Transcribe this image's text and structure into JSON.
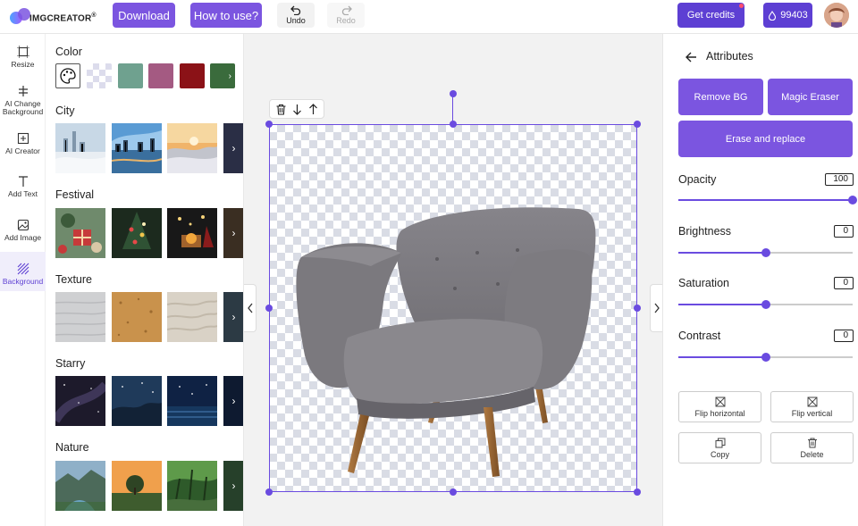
{
  "header": {
    "logo_text": "IMGCREATOR",
    "logo_mark": "®",
    "download_label": "Download",
    "howto_label": "How to use?",
    "undo_label": "Undo",
    "redo_label": "Redo",
    "credits_label": "Get credits",
    "credit_count": "99403",
    "accent_color": "#7b55e0"
  },
  "rail": {
    "items": [
      {
        "label": "Resize",
        "icon": "resize-icon"
      },
      {
        "label": "AI Change Background",
        "icon": "ai-change-background-icon"
      },
      {
        "label": "AI Creator",
        "icon": "ai-creator-icon"
      },
      {
        "label": "Add Text",
        "icon": "text-icon"
      },
      {
        "label": "Add Image",
        "icon": "image-icon"
      },
      {
        "label": "Background",
        "icon": "background-icon"
      }
    ],
    "active": "Background"
  },
  "panel": {
    "color_title": "Color",
    "swatches": [
      "#6fa18f",
      "#a45a82",
      "#8b1217",
      "#3a6b3c"
    ],
    "sections": [
      "City",
      "Festival",
      "Texture",
      "Starry",
      "Nature"
    ]
  },
  "attributes": {
    "title": "Attributes",
    "remove_bg_label": "Remove BG",
    "magic_eraser_label": "Magic Eraser",
    "erase_replace_label": "Erase and replace",
    "sliders": [
      {
        "label": "Opacity",
        "value": "100",
        "fraction": 1.0
      },
      {
        "label": "Brightness",
        "value": "0",
        "fraction": 0.5
      },
      {
        "label": "Saturation",
        "value": "0",
        "fraction": 0.5
      },
      {
        "label": "Contrast",
        "value": "0",
        "fraction": 0.5
      }
    ],
    "actions": {
      "flip_h": "Flip horizontal",
      "flip_v": "Flip vertical",
      "copy": "Copy",
      "delete": "Delete"
    }
  }
}
